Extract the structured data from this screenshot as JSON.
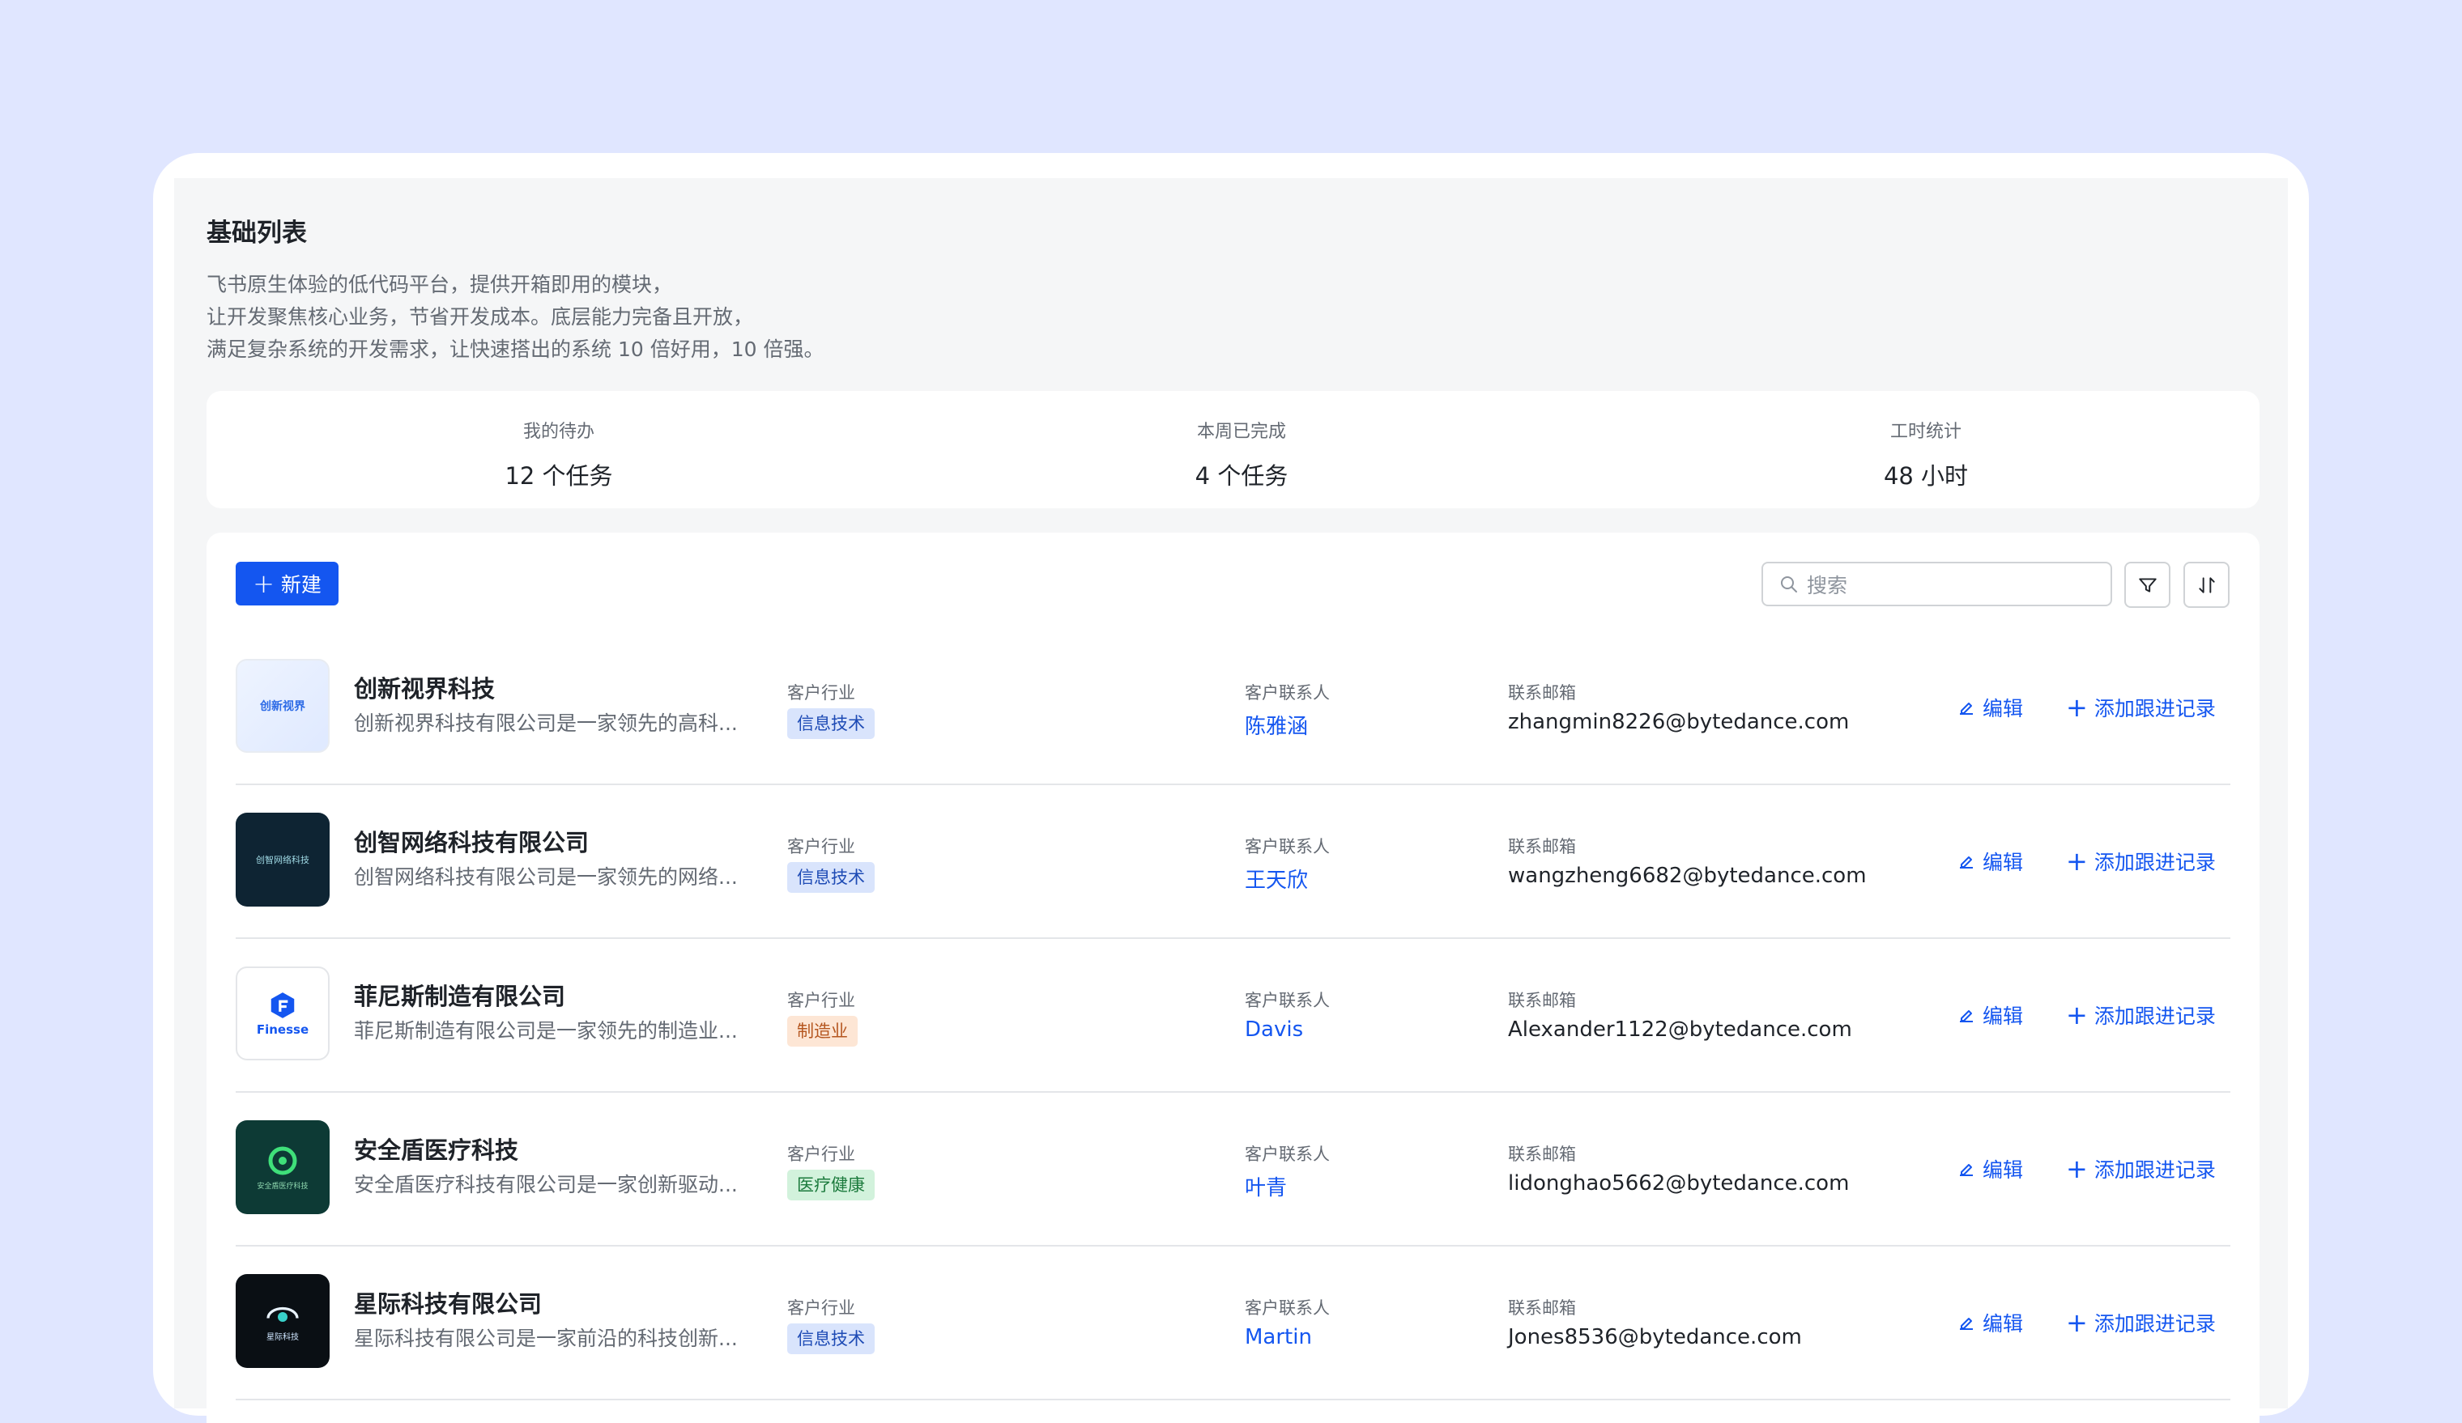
{
  "page": {
    "title": "基础列表",
    "description": [
      "飞书原生体验的低代码平台，提供开箱即用的模块，",
      "让开发聚焦核心业务，节省开发成本。底层能力完备且开放，",
      "满足复杂系统的开发需求，让快速搭出的系统 10 倍好用，10 倍强。"
    ]
  },
  "stats": [
    {
      "label": "我的待办",
      "value": "12 个任务"
    },
    {
      "label": "本周已完成",
      "value": "4 个任务"
    },
    {
      "label": "工时统计",
      "value": "48 小时"
    }
  ],
  "toolbar": {
    "new_label": "新建",
    "search_placeholder": "搜索"
  },
  "labels": {
    "industry": "客户行业",
    "contact": "客户联系人",
    "email": "联系邮箱",
    "edit": "编辑",
    "add_record": "添加跟进记录"
  },
  "rows": [
    {
      "name": "创新视界科技",
      "brief": "创新视界科技有限公司是一家领先的高科...",
      "industry": "信息技术",
      "contact": "陈雅涵",
      "email": "zhangmin8226@bytedance.com",
      "logo_text": "创新视界"
    },
    {
      "name": "创智网络科技有限公司",
      "brief": "创智网络科技有限公司是一家领先的网络...",
      "industry": "信息技术",
      "contact": "王天欣",
      "email": "wangzheng6682@bytedance.com",
      "logo_text": "创智网络科技"
    },
    {
      "name": "菲尼斯制造有限公司",
      "brief": "菲尼斯制造有限公司是一家领先的制造业...",
      "industry": "制造业",
      "contact": "Davis",
      "email": "Alexander1122@bytedance.com",
      "logo_text": "Finesse"
    },
    {
      "name": "安全盾医疗科技",
      "brief": "安全盾医疗科技有限公司是一家创新驱动...",
      "industry": "医疗健康",
      "contact": "叶青",
      "email": "lidonghao5662@bytedance.com",
      "logo_text": "安全盾医疗科技"
    },
    {
      "name": "星际科技有限公司",
      "brief": "星际科技有限公司是一家前沿的科技创新...",
      "industry": "信息技术",
      "contact": "Martin",
      "email": "Jones8536@bytedance.com",
      "logo_text": "星际科技"
    }
  ],
  "colors": {
    "background": "#e0e6ff",
    "accent": "#1456f0",
    "tag_it": "#d9e4fc",
    "tag_manufacturing": "#fde6d5",
    "tag_health": "#d2f2dc"
  }
}
